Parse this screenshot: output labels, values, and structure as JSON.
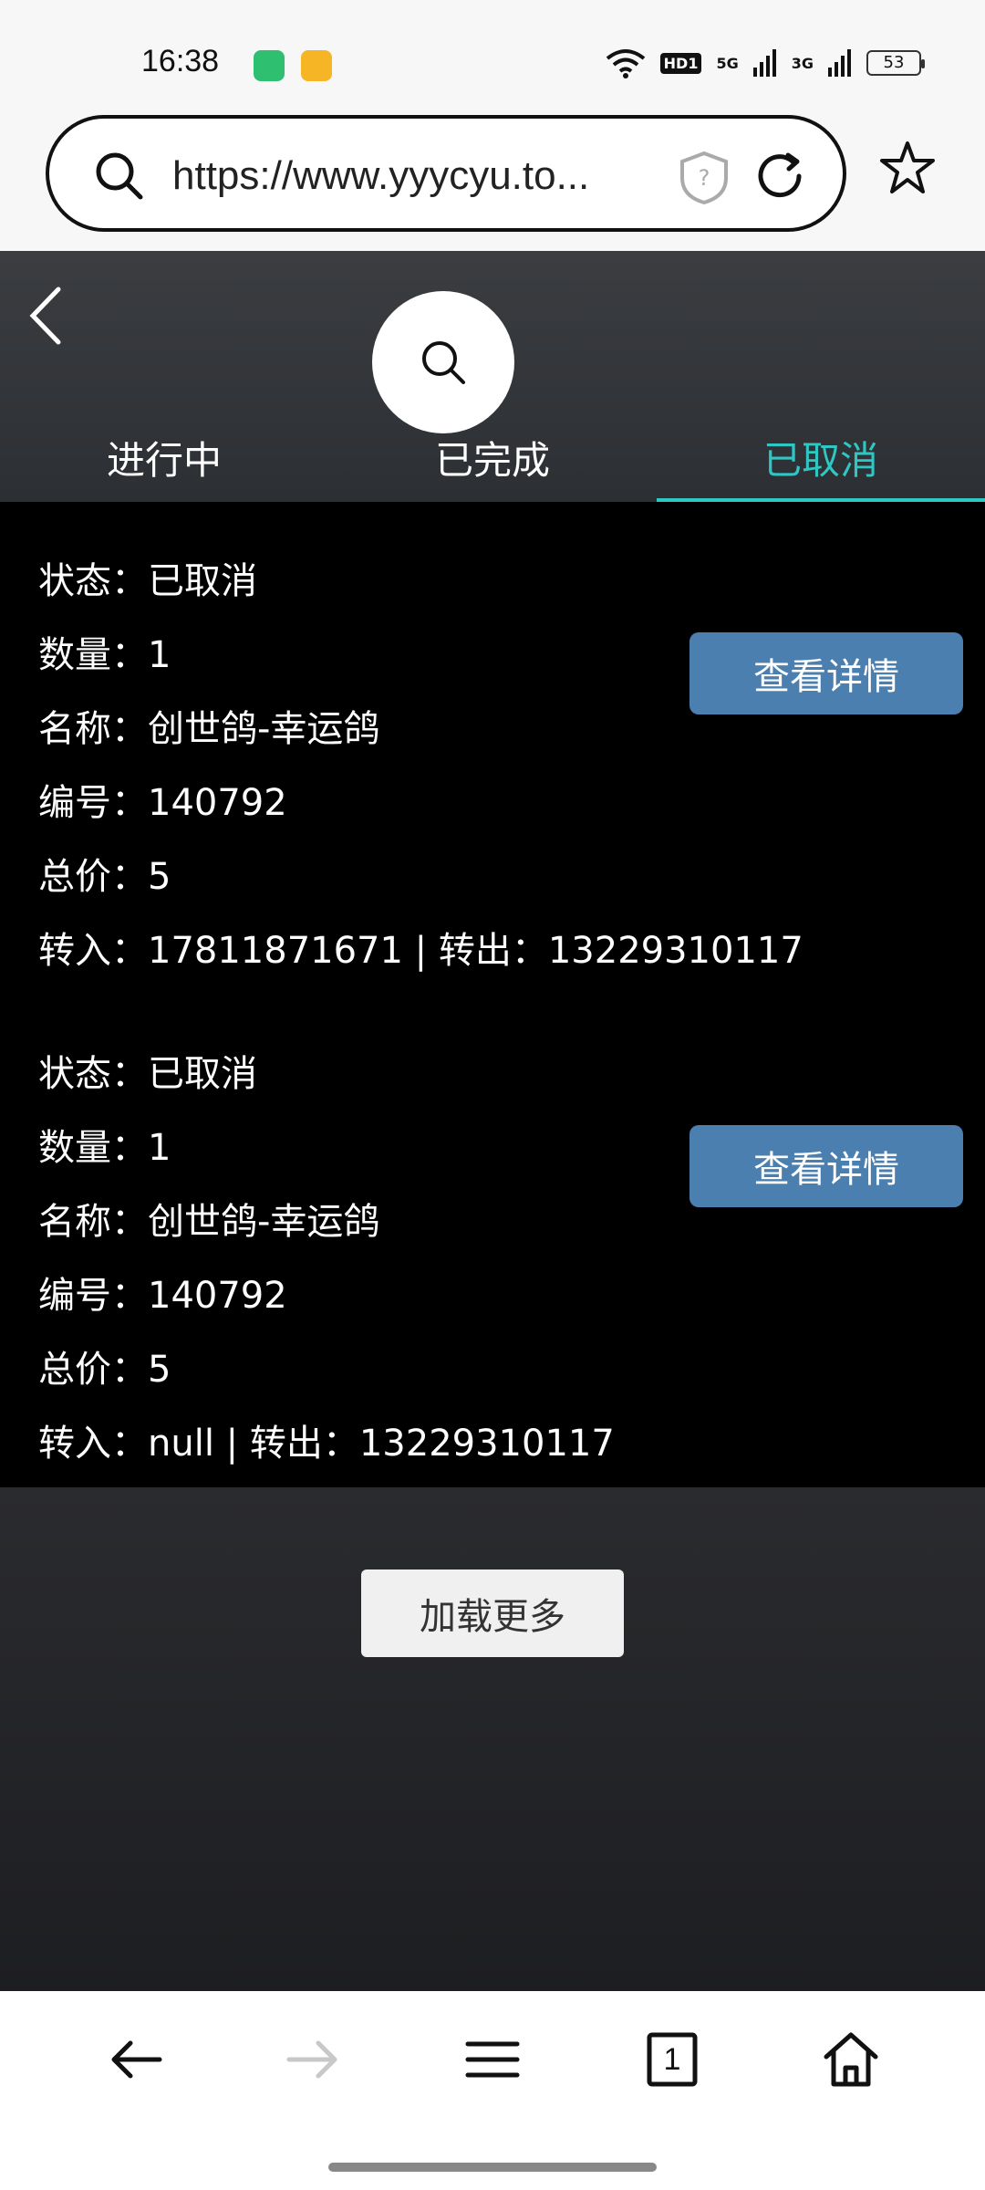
{
  "status_bar": {
    "time": "16:38",
    "signal_1": "5G",
    "signal_2": "3G",
    "hd": "HD1",
    "battery": "53"
  },
  "browser": {
    "url": "https://www.yyycyu.to..."
  },
  "tabs": [
    {
      "label": "进行中",
      "active": false
    },
    {
      "label": "已完成",
      "active": false
    },
    {
      "label": "已取消",
      "active": true
    }
  ],
  "orders": [
    {
      "status_label": "状态：",
      "status": "已取消",
      "qty_label": "数量：",
      "qty": "1",
      "name_label": "名称：",
      "name": "创世鸽-幸运鸽",
      "id_label": "编号：",
      "id": "140792",
      "total_label": "总价：",
      "total": "5",
      "in_label": "转入：",
      "in": "17811871671",
      "sep": " | ",
      "out_label": "转出：",
      "out": "13229310117",
      "detail_button": "查看详情"
    },
    {
      "status_label": "状态：",
      "status": "已取消",
      "qty_label": "数量：",
      "qty": "1",
      "name_label": "名称：",
      "name": "创世鸽-幸运鸽",
      "id_label": "编号：",
      "id": "140792",
      "total_label": "总价：",
      "total": "5",
      "in_label": "转入：",
      "in": "null",
      "sep": " | ",
      "out_label": "转出：",
      "out": "13229310117",
      "detail_button": "查看详情"
    }
  ],
  "load_more": "加载更多",
  "bottom_nav": {
    "tab_count": "1"
  },
  "colors": {
    "accent": "#2ec7c4",
    "button": "#4a7fb0"
  }
}
